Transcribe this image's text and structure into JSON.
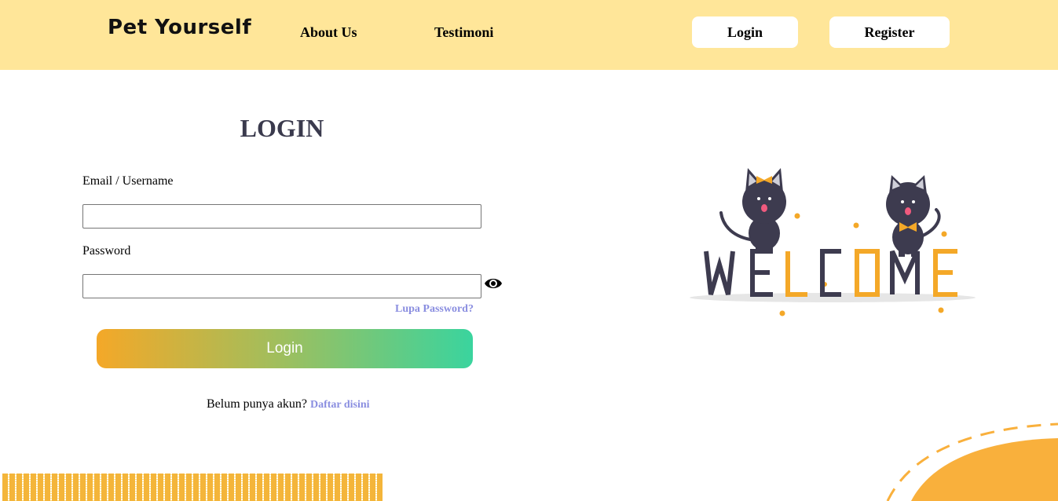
{
  "header": {
    "brand": "Pet Yourself",
    "nav": {
      "about": "About Us",
      "testimoni": "Testimoni"
    },
    "buttons": {
      "login": "Login",
      "register": "Register"
    },
    "bg_color": "#ffe699"
  },
  "form": {
    "title": "LOGIN",
    "email_label": "Email / Username",
    "email_value": "",
    "password_label": "Password",
    "password_value": "",
    "show_password_icon": "eye-icon",
    "forgot_link": "Lupa Password?",
    "submit_label": "Login",
    "signup_prompt": "Belum punya akun?",
    "signup_link": "Daftar disini"
  },
  "illustration": {
    "word": "WELCOME"
  },
  "colors": {
    "accent_orange": "#f4a828",
    "accent_green": "#3ad49e",
    "link": "#8a8ee0",
    "title": "#3a3a4d"
  }
}
